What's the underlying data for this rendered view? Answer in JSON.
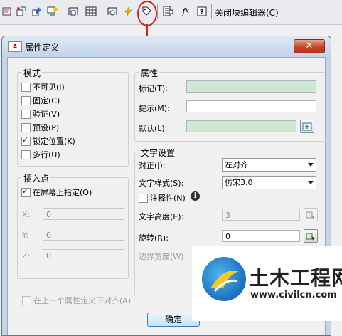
{
  "toolbar": {
    "close_editor_label": "关闭块编辑器(C)",
    "icons": [
      "block-attribute-icon",
      "block-insert-icon",
      "block-parameter-icon",
      "block-save-icon",
      "block-table-icon",
      "grid-table-icon",
      "authoring-palette-icon",
      "lightning-action-icon",
      "attribute-definition-icon",
      "block-properties-icon",
      "fx-parameter-icon",
      "help-icon"
    ]
  },
  "dialog": {
    "title": "属性定义",
    "close_glyph": "✕",
    "mode": {
      "label": "模式",
      "options": [
        {
          "label": "不可见(I)",
          "checked": false
        },
        {
          "label": "固定(C)",
          "checked": false
        },
        {
          "label": "验证(V)",
          "checked": false
        },
        {
          "label": "预设(P)",
          "checked": false
        },
        {
          "label": "锁定位置(K)",
          "checked": true
        },
        {
          "label": "多行(U)",
          "checked": false
        }
      ]
    },
    "insertion": {
      "label": "插入点",
      "on_screen_label": "在屏幕上指定(O)",
      "on_screen_checked": true,
      "x_label": "X:",
      "x_value": "0",
      "y_label": "Y:",
      "y_value": "0",
      "z_label": "Z:",
      "z_value": "0"
    },
    "attribute": {
      "label": "属性",
      "tag_label": "标记(T):",
      "tag_value": "",
      "prompt_label": "提示(M):",
      "prompt_value": "",
      "default_label": "默认(L):",
      "default_value": ""
    },
    "text_settings": {
      "label": "文字设置",
      "justify_label": "对正(J):",
      "justify_value": "左对齐",
      "style_label": "文字样式(S):",
      "style_value": "仿宋3.0",
      "annotative_label": "注释性(N)",
      "annotative_checked": false,
      "info_glyph": "i",
      "height_label": "文字高度(E):",
      "height_value": "3",
      "rotation_label": "旋转(R):",
      "rotation_value": "0",
      "boundary_label": "边界宽度(W)"
    },
    "align_below_label": "在上一个属性定义下对齐(A)",
    "ok_label": "确定"
  },
  "watermark": {
    "title": "土木工程网",
    "url": "www.civilcn.com"
  },
  "colors": {
    "annotation_red": "#d62020",
    "field_green": "#cfe8d4",
    "close_red": "#c4442b",
    "logo_blue": "#1a6fbf"
  }
}
